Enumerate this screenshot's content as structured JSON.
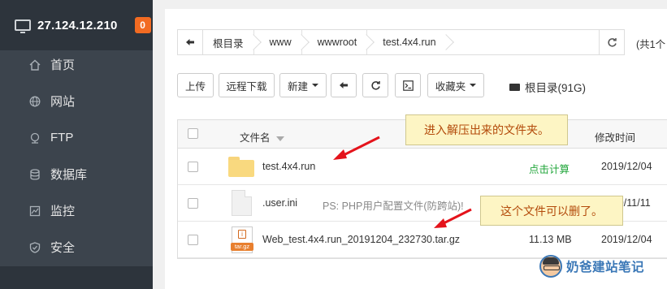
{
  "sidebar": {
    "server_ip": "27.124.12.210",
    "badge": "0",
    "items": [
      {
        "label": "首页",
        "icon": "home-icon"
      },
      {
        "label": "网站",
        "icon": "globe-icon"
      },
      {
        "label": "FTP",
        "icon": "ftp-icon"
      },
      {
        "label": "数据库",
        "icon": "database-icon"
      },
      {
        "label": "监控",
        "icon": "monitor-chart-icon"
      },
      {
        "label": "安全",
        "icon": "shield-icon"
      }
    ]
  },
  "path": {
    "crumbs": [
      "根目录",
      "www",
      "wwwroot",
      "test.4x4.run"
    ],
    "total_text": "(共1个"
  },
  "toolbar": {
    "upload": "上传",
    "remote_download": "远程下载",
    "new": "新建",
    "favorites": "收藏夹",
    "disk": "根目录(91G)"
  },
  "table": {
    "headers": {
      "name": "文件名",
      "mtime": "修改时间"
    },
    "rows": [
      {
        "name": "test.4x4.run",
        "size": "点击计算",
        "mtime": "2019/12/04",
        "type": "folder"
      },
      {
        "name": ".user.ini",
        "note": "PS: PHP用户配置文件(防跨站)!",
        "mtime": "2019/11/11",
        "type": "file"
      },
      {
        "name": "Web_test.4x4.run_20191204_232730.tar.gz",
        "size": "11.13 MB",
        "mtime": "2019/12/04",
        "type": "archive",
        "icon_text": "tar.gz"
      }
    ]
  },
  "annotations": {
    "note1": "进入解压出来的文件夹。",
    "note2": "这个文件可以删了。"
  },
  "watermark": "奶爸建站笔记",
  "colors": {
    "sidebar_bg": "#3c444d",
    "sidebar_head_bg": "#2d343c",
    "badge": "#f26b22",
    "calc_link": "#20a53a",
    "note_text": "#b34a0a",
    "arrow": "#e4131b"
  }
}
